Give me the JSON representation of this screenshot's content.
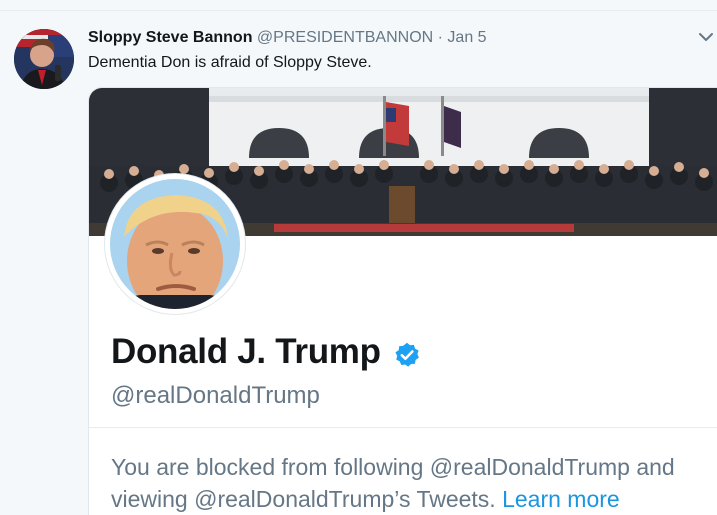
{
  "tweet": {
    "display_name": "Sloppy Steve Bannon",
    "handle": "@PRESIDENTBANNON",
    "separator": "·",
    "date": "Jan 5",
    "text": "Dementia Don is afraid of Sloppy Steve.",
    "avatar_icon": "user-avatar",
    "menu_icon": "chevron-down-icon"
  },
  "card": {
    "name": "Donald J. Trump",
    "verified_icon": "verified-badge-icon",
    "handle": "@realDonaldTrump",
    "blocked_text": "You are blocked from following @realDonaldTrump and viewing @realDonaldTrump’s Tweets.",
    "learn_more": "Learn more"
  },
  "colors": {
    "background": "#f5f8fa",
    "card_bg": "#ffffff",
    "text_primary": "#14171a",
    "text_secondary": "#657786",
    "link": "#1b95e0",
    "verified": "#1da1f2"
  }
}
